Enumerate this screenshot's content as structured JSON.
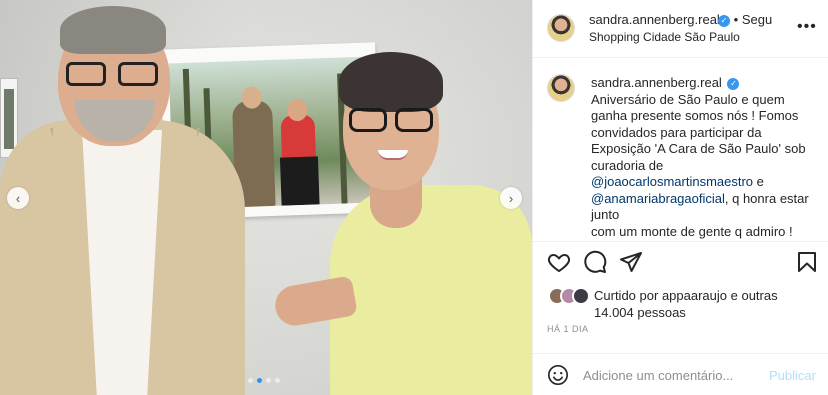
{
  "post": {
    "username": "sandra.annenberg.real",
    "separator": "•",
    "follow_label": "Segu",
    "location": "Shopping Cidade São Paulo",
    "more_label": "•••"
  },
  "caption": {
    "username": "sandra.annenberg.real",
    "line1": "Aniversário de São Paulo e quem ganha presente somos nós ! Fomos convidados para participar da Exposição 'A Cara de São Paulo' sob curadoria de",
    "mention1": "@joaocarlosmartinsmaestro",
    "connector": " e",
    "mention2": "@anamariabragaoficial",
    "line2": ", q honra estar junto",
    "line3": "com um monte de gente q admiro !"
  },
  "likes": {
    "prefix": "Curtido por",
    "user": "appaaraujo",
    "suffix": "e outras 14.004 pessoas"
  },
  "time_ago": "HÁ 1 DIA",
  "comment": {
    "placeholder": "Adicione um comentário...",
    "post_label": "Publicar"
  },
  "carousel": {
    "prev_label": "‹",
    "next_label": "›",
    "slide_count": 4,
    "active_index": 1
  },
  "colors": {
    "verified": "#3897f0",
    "carousel_active_dot": "#3a8ef6",
    "mention": "#00376b",
    "post_disabled": "#b2dffc"
  },
  "icons": {
    "like": "heart-icon",
    "comment": "comment-icon",
    "share": "paper-plane-icon",
    "save": "bookmark-icon",
    "emoji": "smiley-icon",
    "verified": "verified-badge-icon"
  }
}
